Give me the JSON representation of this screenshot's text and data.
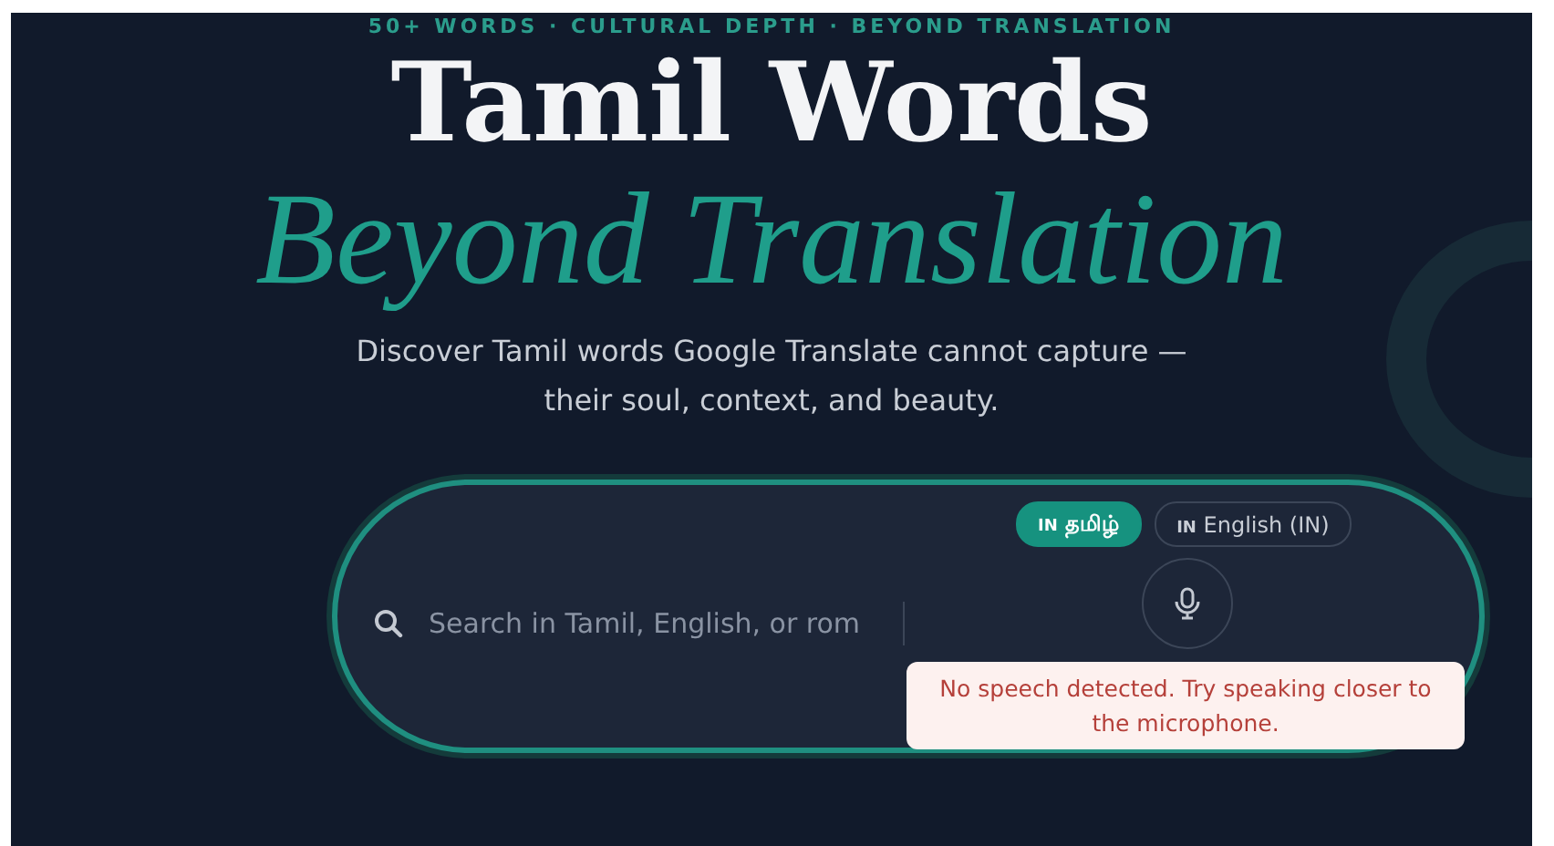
{
  "tagline": "50+ WORDS · CULTURAL DEPTH · BEYOND TRANSLATION",
  "title": "Tamil Words",
  "subtitle": "Beyond Translation",
  "description": "Discover Tamil words Google Translate cannot capture — their soul, context, and beauty.",
  "search": {
    "placeholder": "Search in Tamil, English, or rom",
    "languages": [
      {
        "flag": "IN",
        "label": "தமிழ்",
        "selected": true
      },
      {
        "flag": "IN",
        "label": "English (IN)",
        "selected": false
      }
    ],
    "error": "No speech detected. Try speaking closer to the microphone."
  }
}
